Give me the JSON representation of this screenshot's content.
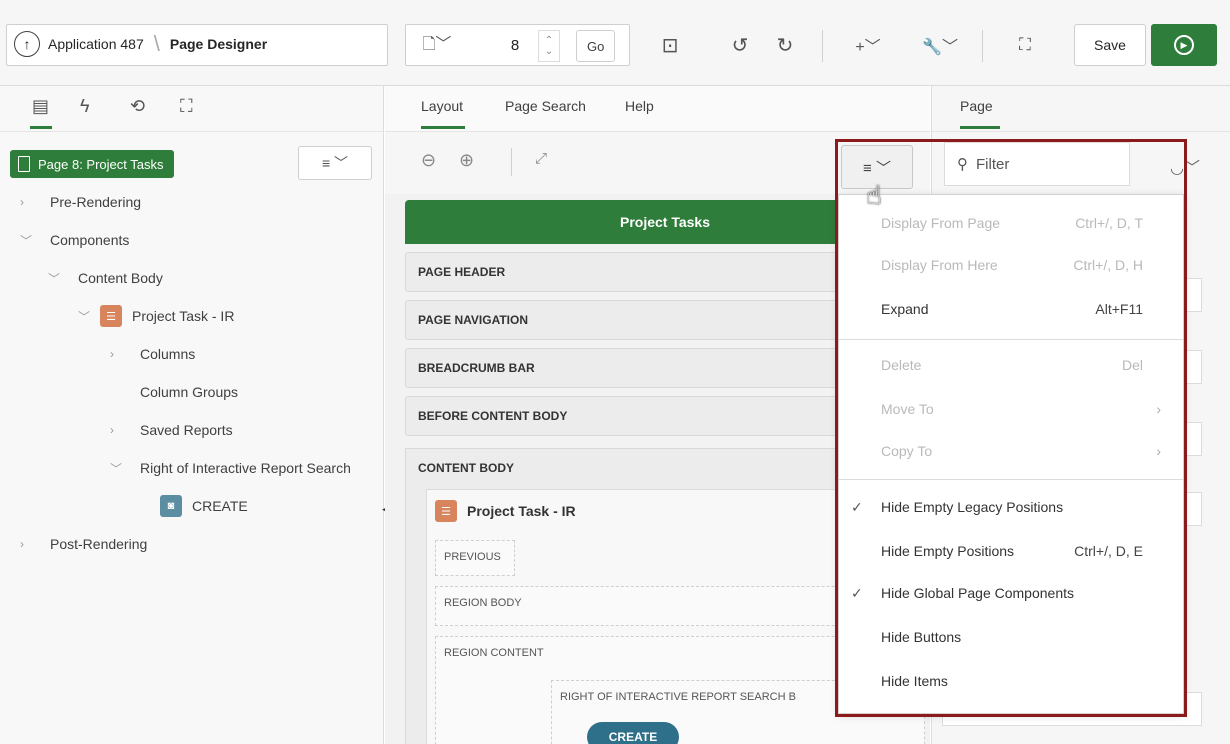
{
  "toolbar": {
    "app_label": "Application 487",
    "page_designer": "Page Designer",
    "page_number": "8",
    "go_label": "Go",
    "save_label": "Save"
  },
  "left_pane": {
    "page_pill": "Page 8: Project Tasks",
    "tree": [
      {
        "label": "Pre-Rendering"
      },
      {
        "label": "Components"
      },
      {
        "label": "Content Body"
      },
      {
        "label": "Project Task - IR"
      },
      {
        "label": "Columns"
      },
      {
        "label": "Column Groups"
      },
      {
        "label": "Saved Reports"
      },
      {
        "label": "Right of Interactive Report Search"
      },
      {
        "label": "CREATE"
      },
      {
        "label": "Post-Rendering"
      }
    ]
  },
  "center": {
    "tabs": [
      "Layout",
      "Page Search",
      "Help"
    ],
    "page_title": "Project Tasks",
    "positions": [
      "PAGE HEADER",
      "PAGE NAVIGATION",
      "BREADCRUMB BAR",
      "BEFORE CONTENT BODY"
    ],
    "content_body": "CONTENT BODY",
    "region_title": "Project Task - IR",
    "sub_positions": [
      "PREVIOUS",
      "REGION BODY",
      "REGION CONTENT",
      "RIGHT OF INTERACTIVE REPORT SEARCH B"
    ],
    "create_chip": "CREATE"
  },
  "right_pane": {
    "tab": "Page",
    "filter_placeholder": "Filter"
  },
  "menu": {
    "items": [
      {
        "label": "Display From Page",
        "shortcut": "Ctrl+/, D, T",
        "disabled": true,
        "checked": false
      },
      {
        "label": "Display From Here",
        "shortcut": "Ctrl+/, D, H",
        "disabled": true,
        "checked": false
      },
      {
        "label": "Expand",
        "shortcut": "Alt+F11",
        "disabled": false,
        "checked": false
      },
      {
        "label": "Delete",
        "shortcut": "Del",
        "disabled": true,
        "checked": false
      },
      {
        "label": "Move To",
        "shortcut": "",
        "disabled": true,
        "checked": false
      },
      {
        "label": "Copy To",
        "shortcut": "",
        "disabled": true,
        "checked": false
      },
      {
        "label": "Hide Empty Legacy Positions",
        "shortcut": "",
        "disabled": false,
        "checked": true
      },
      {
        "label": "Hide Empty Positions",
        "shortcut": "Ctrl+/, D, E",
        "disabled": false,
        "checked": false
      },
      {
        "label": "Hide Global Page Components",
        "shortcut": "",
        "disabled": false,
        "checked": true
      },
      {
        "label": "Hide Buttons",
        "shortcut": "",
        "disabled": false,
        "checked": false
      },
      {
        "label": "Hide Items",
        "shortcut": "",
        "disabled": false,
        "checked": false
      }
    ]
  },
  "colors": {
    "accent": "#2e7d3a",
    "highlight_border": "#8b1a1a"
  }
}
